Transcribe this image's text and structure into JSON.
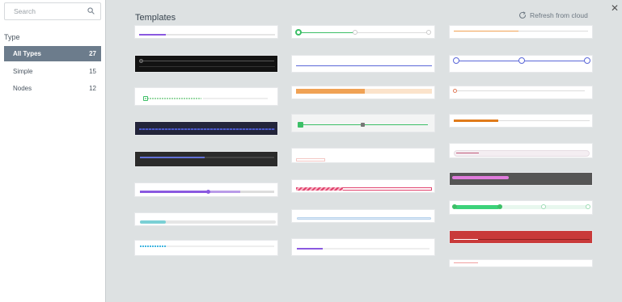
{
  "search": {
    "placeholder": "Search"
  },
  "sidebar": {
    "type_label": "Type",
    "items": [
      {
        "label": "All Types",
        "count": "27"
      },
      {
        "label": "Simple",
        "count": "15"
      },
      {
        "label": "Nodes",
        "count": "12"
      }
    ]
  },
  "main": {
    "title": "Templates",
    "refresh_label": "Refresh from cloud"
  },
  "colors": {
    "accent_purple": "#8a59e0",
    "green": "#3cbf67",
    "orange": "#f0a254",
    "active_nav": "#6c7c8c",
    "red": "#c93a3a",
    "pink": "#e06ad6"
  },
  "icons": [
    "search-icon",
    "refresh-icon",
    "close-icon"
  ]
}
